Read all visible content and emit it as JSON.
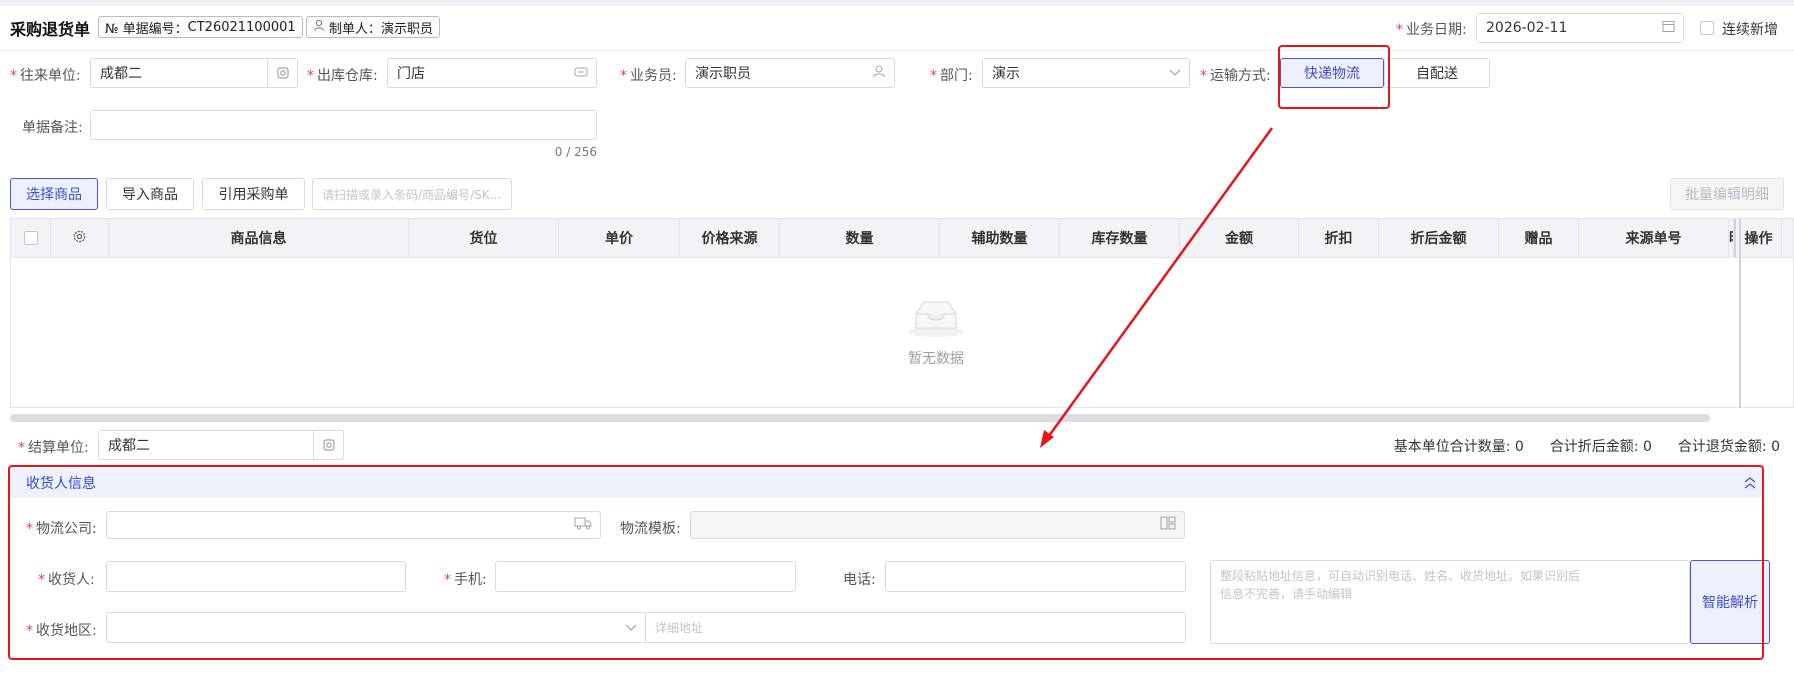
{
  "header": {
    "title": "采购退货单",
    "doc_no_label": "№ 单据编号：",
    "doc_no": "CT26021100001",
    "creator_label": "制单人：",
    "creator": "演示职员",
    "biz_date_label": "业务日期:",
    "biz_date": "2026-02-11",
    "continuous_add": "连续新增"
  },
  "form": {
    "partner_label": "往来单位:",
    "partner_value": "成都二",
    "warehouse_label": "出库仓库:",
    "warehouse_value": "门店",
    "salesman_label": "业务员:",
    "salesman_value": "演示职员",
    "dept_label": "部门:",
    "dept_value": "演示",
    "shipping_label": "运输方式:",
    "shipping_options": [
      "快递物流",
      "自配送"
    ],
    "remark_label": "单据备注:",
    "remark_counter": "0 / 256"
  },
  "toolbar": {
    "select_goods": "选择商品",
    "import_goods": "导入商品",
    "quote_po": "引用采购单",
    "scan_placeholder": "请扫描或录入条码/商品编号/SK...",
    "batch_edit": "批量编辑明细"
  },
  "table": {
    "columns": [
      "商品信息",
      "货位",
      "单价",
      "价格来源",
      "数量",
      "辅助数量",
      "库存数量",
      "金额",
      "折扣",
      "折后金额",
      "赠品",
      "来源单号",
      "明",
      "操作"
    ],
    "empty_text": "暂无数据"
  },
  "settlement": {
    "label": "结算单位:",
    "value": "成都二",
    "sum_qty_label": "基本单位合计数量:",
    "sum_qty": "0",
    "sum_discount_label": "合计折后金额:",
    "sum_discount": "0",
    "sum_return_label": "合计退货金额:",
    "sum_return": "0"
  },
  "consignee": {
    "section_title": "收货人信息",
    "logistics_company_label": "物流公司:",
    "logistics_template_label": "物流模板:",
    "receiver_label": "收货人:",
    "mobile_label": "手机:",
    "phone_label": "电话:",
    "region_label": "收货地区:",
    "address_placeholder": "详细地址",
    "smart_placeholder": "整段粘贴地址信息，可自动识别电话、姓名、收货地址。如果识别后信息不完善，请手动编辑",
    "smart_parse": "智能解析"
  },
  "colors": {
    "accent": "#3b4ec9",
    "required": "#e54545",
    "annotation": "#e8141c"
  }
}
